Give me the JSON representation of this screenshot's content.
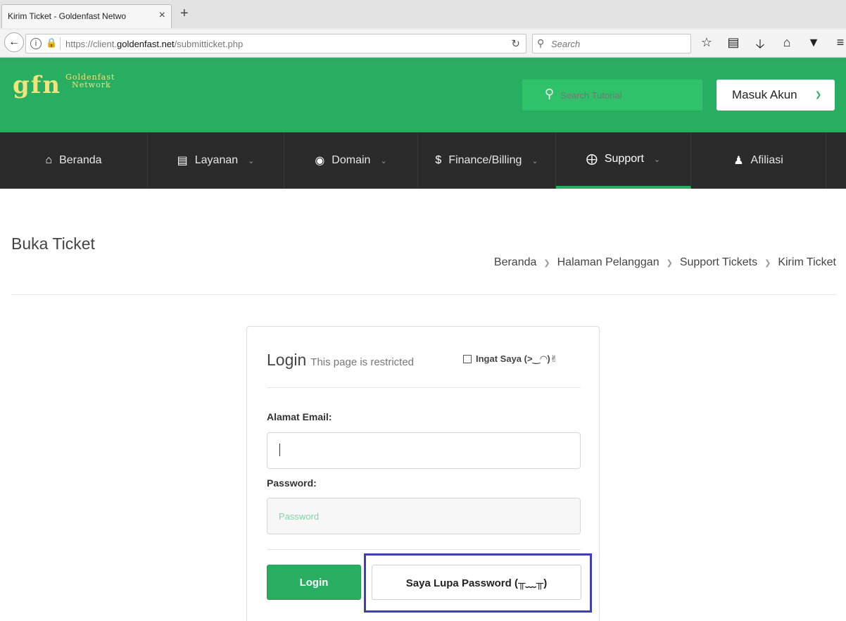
{
  "browser": {
    "tab_title": "Kirim Ticket - Goldenfast Netwo",
    "tab_close": "×",
    "new_tab": "+",
    "url_prefix": "https://client.",
    "url_domain": "goldenfast.net",
    "url_path": "/submitticket.php",
    "search_placeholder": "Search"
  },
  "header": {
    "logo_mark": "gfn",
    "logo_line1": "Goldenfast",
    "logo_line2": "Network",
    "search_placeholder": "Search Tutorial",
    "account_button": "Masuk Akun"
  },
  "nav": {
    "items": [
      {
        "label": "Beranda"
      },
      {
        "label": "Layanan"
      },
      {
        "label": "Domain"
      },
      {
        "label": "Finance/Billing"
      },
      {
        "label": "Support"
      },
      {
        "label": "Afiliasi"
      }
    ]
  },
  "page": {
    "title": "Buka Ticket",
    "breadcrumb": [
      "Beranda",
      "Halaman Pelanggan",
      "Support Tickets",
      "Kirim Ticket"
    ]
  },
  "login": {
    "title": "Login",
    "subtitle": "This page is restricted",
    "remember_label": "Ingat Saya (>‿◠)✌",
    "email_label": "Alamat Email:",
    "email_value": "",
    "password_label": "Password:",
    "password_placeholder": "Password",
    "login_button": "Login",
    "forgot_button": "Saya Lupa Password (╥﹏╥)"
  },
  "colors": {
    "brand_green": "#27ae60",
    "nav_dark": "#2b2b2b",
    "logo_gold": "#f2e37a",
    "highlight": "#3f3fb4"
  }
}
